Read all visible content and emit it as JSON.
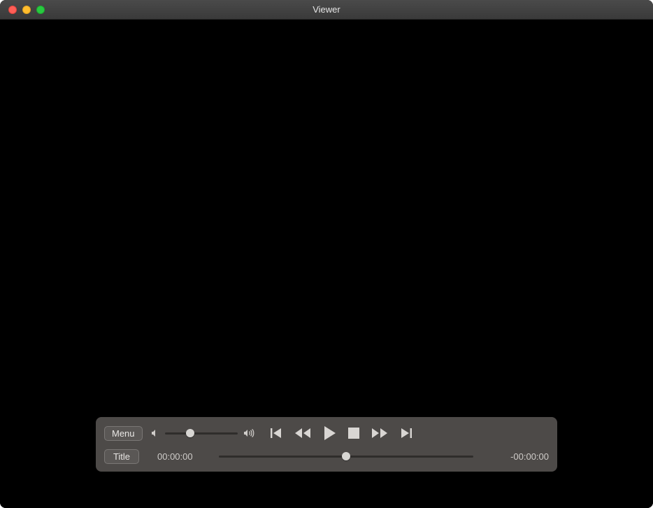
{
  "window": {
    "title": "Viewer"
  },
  "controller": {
    "menu_label": "Menu",
    "title_label": "Title",
    "volume_percent": 35,
    "time_elapsed": "00:00:00",
    "time_remaining": "-00:00:00",
    "seek_percent": 50
  }
}
